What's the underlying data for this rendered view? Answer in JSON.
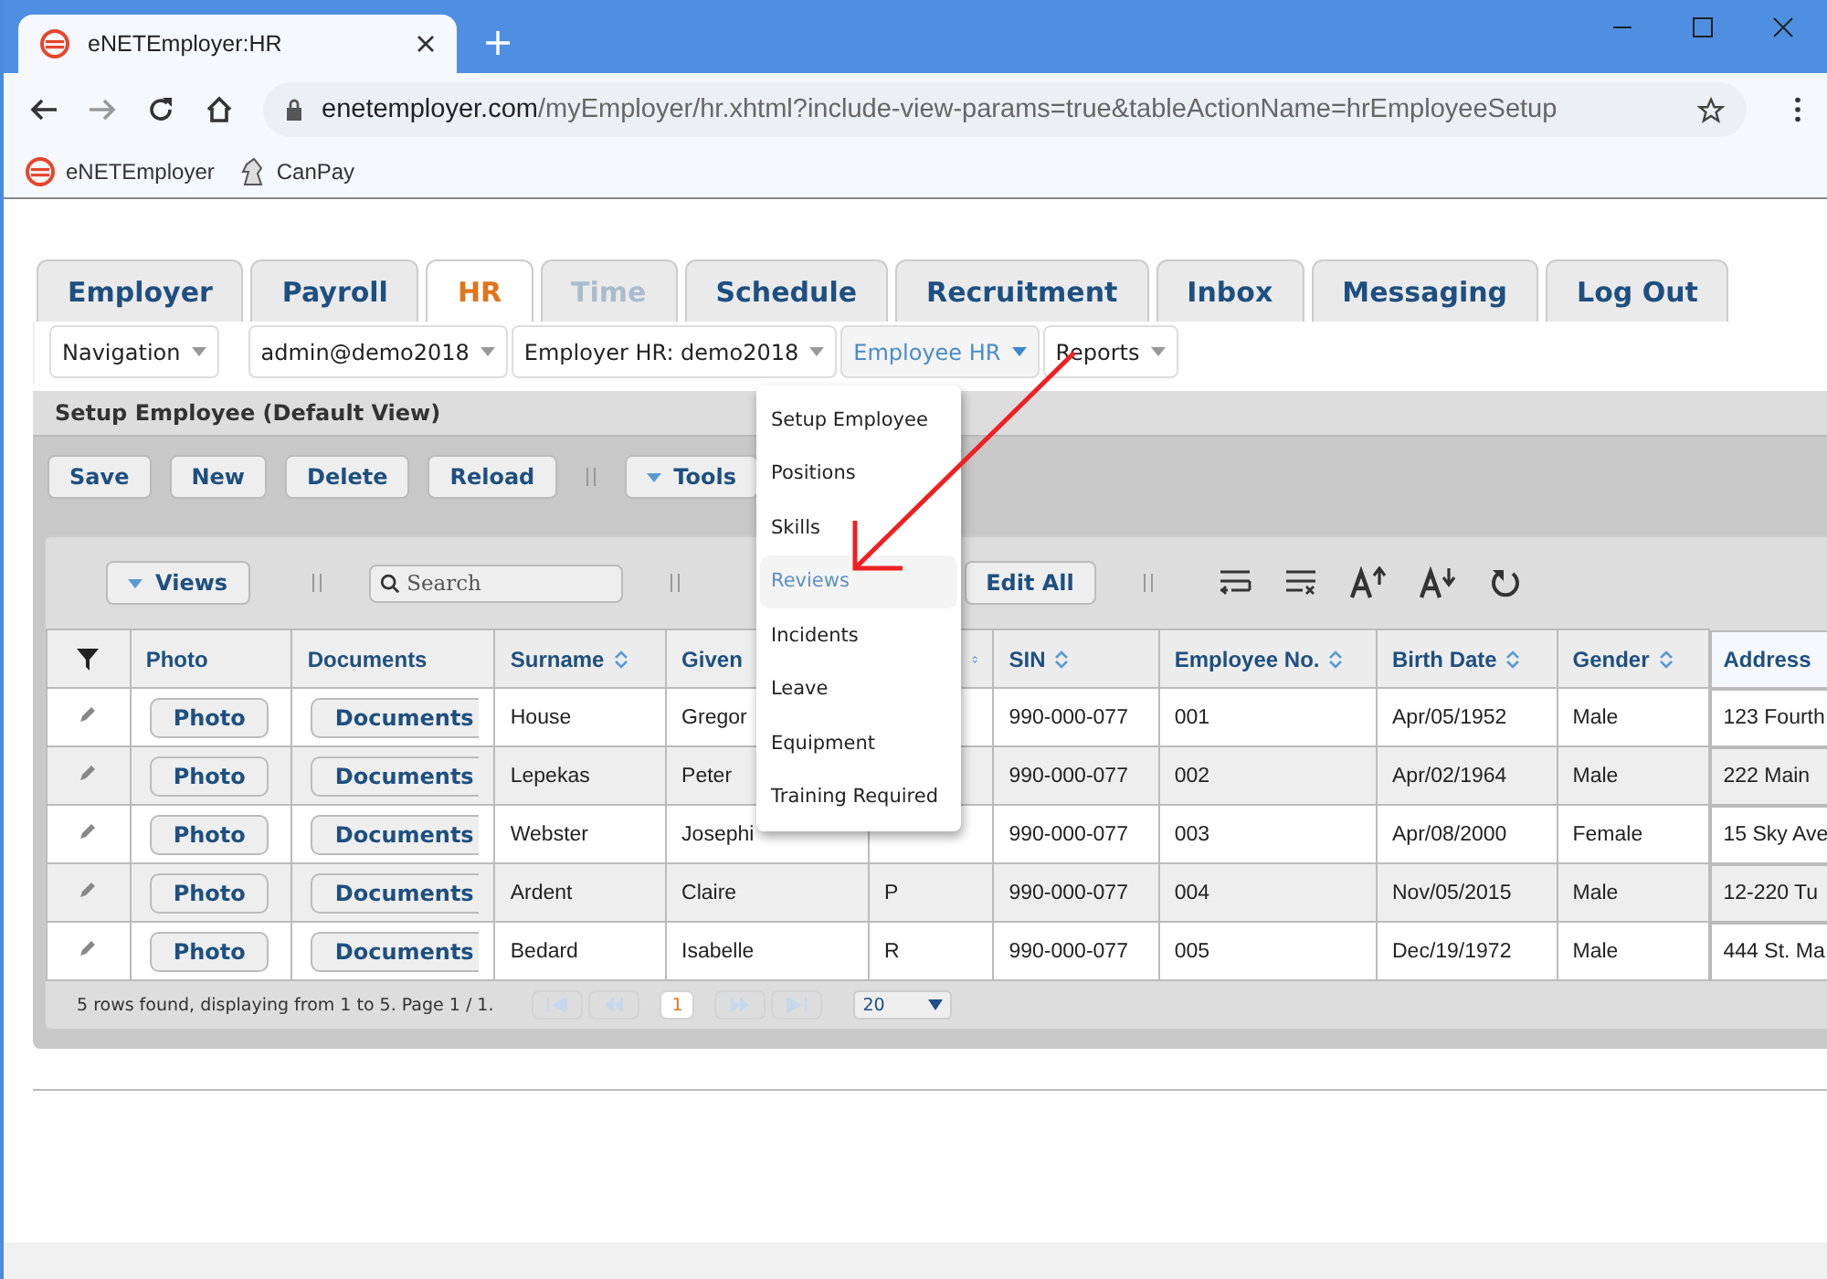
{
  "browser": {
    "tab_title": "eNETEmployer:HR",
    "url_domain": "enetemployer.com",
    "url_path": "/myEmployer/hr.xhtml?include-view-params=true&tableActionName=hrEmployeeSetup",
    "bookmarks": [
      {
        "label": "eNETEmployer",
        "kind": "logo"
      },
      {
        "label": "CanPay",
        "kind": "horse"
      }
    ]
  },
  "main_tabs": [
    {
      "label": "Employer",
      "selected": false,
      "disabled": false
    },
    {
      "label": "Payroll",
      "selected": false,
      "disabled": false
    },
    {
      "label": "HR",
      "selected": true,
      "disabled": false
    },
    {
      "label": "Time",
      "selected": false,
      "disabled": true
    },
    {
      "label": "Schedule",
      "selected": false,
      "disabled": false
    },
    {
      "label": "Recruitment",
      "selected": false,
      "disabled": false
    },
    {
      "label": "Inbox",
      "selected": false,
      "disabled": false
    },
    {
      "label": "Messaging",
      "selected": false,
      "disabled": false
    },
    {
      "label": "Log Out",
      "selected": false,
      "disabled": false
    }
  ],
  "nav_menus": [
    {
      "label": "Navigation",
      "selected": false
    },
    {
      "label": "admin@demo2018",
      "selected": false
    },
    {
      "label": "Employer HR: demo2018",
      "selected": false
    },
    {
      "label": "Employee HR",
      "selected": true
    },
    {
      "label": "Reports",
      "selected": false
    }
  ],
  "dropdown": {
    "items": [
      {
        "label": "Setup Employee",
        "highlighted": false
      },
      {
        "label": "Positions",
        "highlighted": false
      },
      {
        "label": "Skills",
        "highlighted": false
      },
      {
        "label": "Reviews",
        "highlighted": true
      },
      {
        "label": "Incidents",
        "highlighted": false
      },
      {
        "label": "Leave",
        "highlighted": false
      },
      {
        "label": "Equipment",
        "highlighted": false
      },
      {
        "label": "Training Required",
        "highlighted": false
      }
    ]
  },
  "panel_title": "Setup Employee (Default View)",
  "toolbar": [
    {
      "label": "Save",
      "kind": "button"
    },
    {
      "label": "New",
      "kind": "button"
    },
    {
      "label": "Delete",
      "kind": "button"
    },
    {
      "label": "Reload",
      "kind": "button"
    },
    {
      "label": "Tools",
      "kind": "dropdown"
    }
  ],
  "table_toolbar": {
    "views": "Views",
    "search_placeholder": "Search",
    "edit_all": "Edit All"
  },
  "table": {
    "columns": [
      {
        "label": "Photo",
        "kind": "button",
        "sortable": false
      },
      {
        "label": "Documents",
        "kind": "button",
        "sortable": false
      },
      {
        "label": "Surname",
        "kind": "text",
        "sortable": true
      },
      {
        "label": "Given",
        "kind": "text"
      },
      {
        "kind": "text",
        "sortable": true
      },
      {
        "label": "SIN",
        "kind": "text",
        "sortable": true
      },
      {
        "label": "Employee No.",
        "kind": "text",
        "sortable": true
      },
      {
        "label": "Birth Date",
        "kind": "text",
        "sortable": true
      },
      {
        "label": "Gender",
        "kind": "text",
        "sortable": true
      },
      {
        "label": "Address",
        "kind": "text",
        "sortable": false
      }
    ],
    "rows": [
      {
        "cells": [
          "Photo",
          "Documents",
          "House",
          "Gregor",
          null,
          "990-000-077",
          "001",
          "Apr/05/1952",
          "Male",
          "123 Fourth"
        ]
      },
      {
        "cells": [
          "Photo",
          "Documents",
          "Lepekas",
          "Peter",
          null,
          "990-000-077",
          "002",
          "Apr/02/1964",
          "Male",
          "222 Main"
        ]
      },
      {
        "cells": [
          "Photo",
          "Documents",
          "Webster",
          "Josephi",
          null,
          "990-000-077",
          "003",
          "Apr/08/2000",
          "Female",
          "15 Sky Ave"
        ]
      },
      {
        "cells": [
          "Photo",
          "Documents",
          "Ardent",
          "Claire",
          "P",
          "990-000-077",
          "004",
          "Nov/05/2015",
          "Male",
          "12-220 Tu"
        ]
      },
      {
        "cells": [
          "Photo",
          "Documents",
          "Bedard",
          "Isabelle",
          "R",
          "990-000-077",
          "005",
          "Dec/19/1972",
          "Male",
          "444 St. Ma"
        ]
      }
    ]
  },
  "footer": {
    "summary": "5 rows found, displaying from 1 to 5. Page 1 / 1.",
    "pages": [
      {
        "label": "1",
        "selected": true
      }
    ],
    "page_size": "20"
  }
}
